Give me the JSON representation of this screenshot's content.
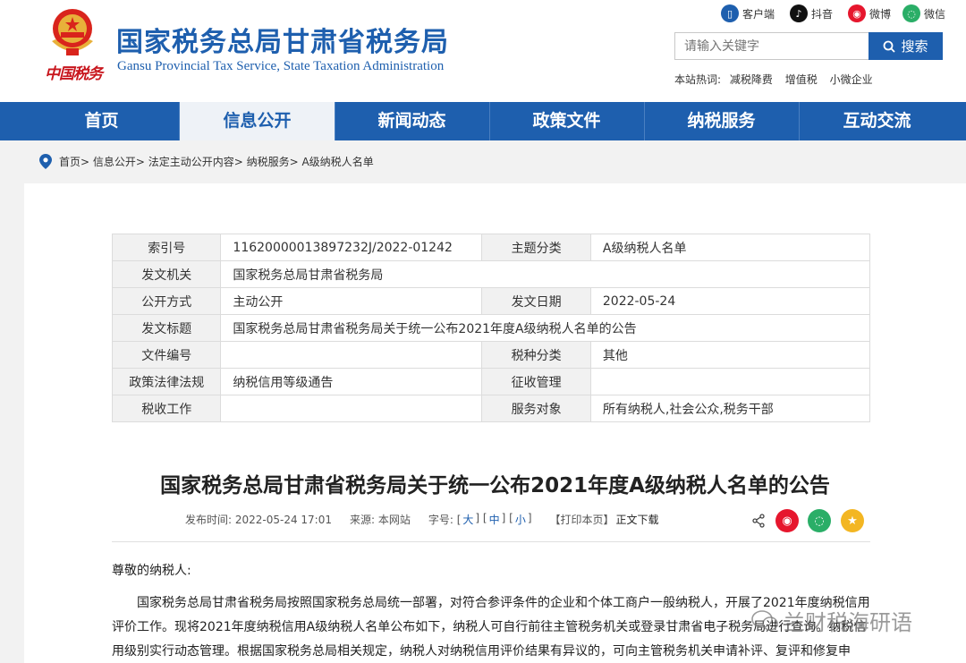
{
  "header": {
    "title": "国家税务总局甘肃省税务局",
    "subtitle": "Gansu Provincial Tax Service, State Taxation Administration",
    "seal_text": "中国税务",
    "social": [
      {
        "label": "客户端",
        "color": "#1e5fae",
        "icon": "mobile-icon"
      },
      {
        "label": "抖音",
        "color": "#111111",
        "icon": "tiktok-icon"
      },
      {
        "label": "微博",
        "color": "#e6162d",
        "icon": "weibo-icon"
      },
      {
        "label": "微信",
        "color": "#2aae67",
        "icon": "wechat-icon"
      }
    ],
    "search_placeholder": "请输入关键字",
    "search_button": "搜索",
    "hot_label": "本站热词:",
    "hot_words": [
      "减税降费",
      "增值税",
      "小微企业"
    ]
  },
  "nav": {
    "items": [
      "首页",
      "信息公开",
      "新闻动态",
      "政策文件",
      "纳税服务",
      "互动交流"
    ],
    "active_index": 1
  },
  "breadcrumb": "首页> 信息公开> 法定主动公开内容> 纳税服务> A级纳税人名单",
  "meta": {
    "index_no_label": "索引号",
    "index_no": "11620000013897232J/2022-01242",
    "topic_label": "主题分类",
    "topic": "A级纳税人名单",
    "issuer_label": "发文机关",
    "issuer": "国家税务总局甘肃省税务局",
    "open_label": "公开方式",
    "open": "主动公开",
    "date_label": "发文日期",
    "date": "2022-05-24",
    "doc_title_label": "发文标题",
    "doc_title": "国家税务总局甘肃省税务局关于统一公布2021年度A级纳税人名单的公告",
    "doc_no_label": "文件编号",
    "doc_no": "",
    "tax_type_label": "税种分类",
    "tax_type": "其他",
    "law_label": "政策法律法规",
    "law": "纳税信用等级通告",
    "collection_label": "征收管理",
    "collection": "",
    "work_label": "税收工作",
    "work": "",
    "service_label": "服务对象",
    "service": "所有纳税人,社会公众,税务干部"
  },
  "article": {
    "title": "国家税务总局甘肃省税务局关于统一公布2021年度A级纳税人名单的公告",
    "publish": "发布时间: 2022-05-24 17:01",
    "source": "来源: 本网站",
    "font_size_label": "字号: [",
    "font_large": "大",
    "font_medium": "中",
    "font_small": "小",
    "print": "【打印本页】",
    "download": "正文下载",
    "greeting": "尊敬的纳税人:",
    "paragraph": "国家税务总局甘肃省税务局按照国家税务总局统一部署，对符合参评条件的企业和个体工商户一般纳税人，开展了2021年度纳税信用评价工作。现将2021年度纳税信用A级纳税人名单公布如下，纳税人可自行前往主管税务机关或登录甘肃省电子税务局进行查询。纳税信用级别实行动态管理。根据国家税务总局相关规定，纳税人对纳税信用评价结果有异议的，可向主管税务机关申请补评、复评和修复申请。"
  },
  "watermark": "兰财税海研语"
}
